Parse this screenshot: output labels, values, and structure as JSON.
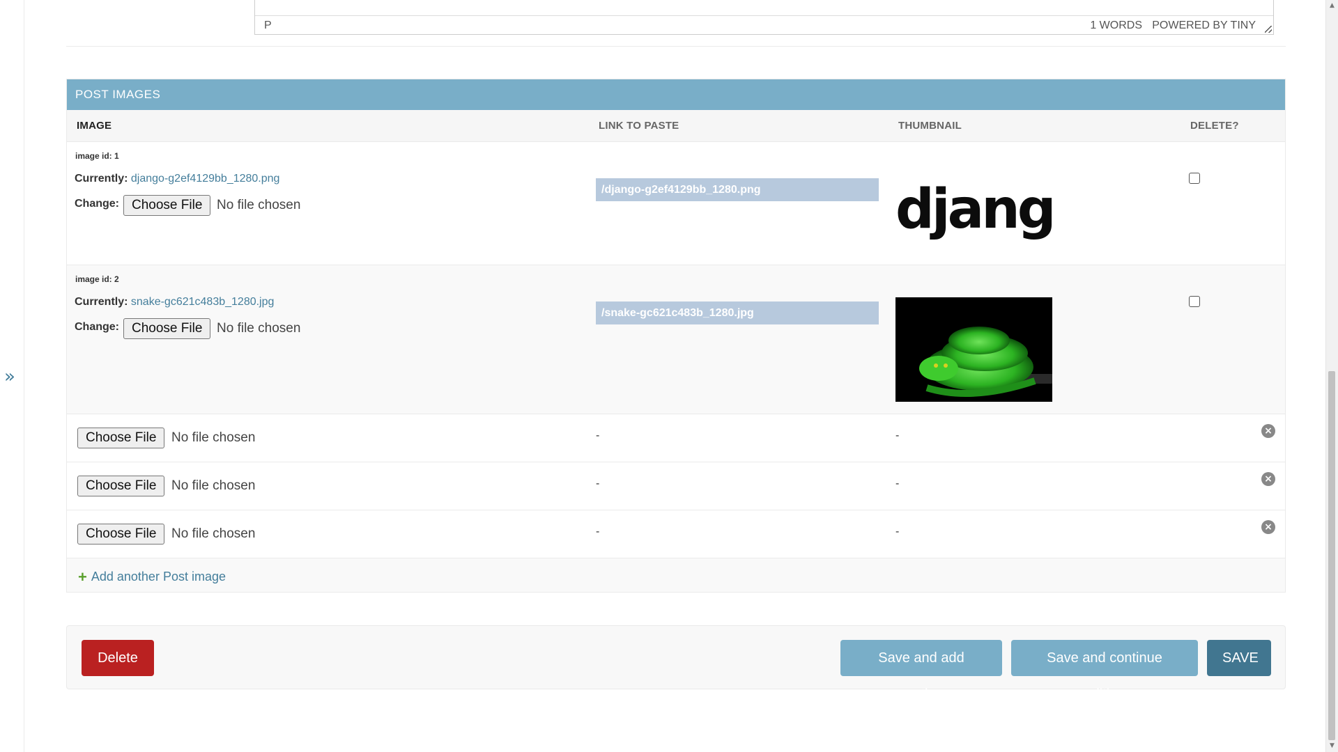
{
  "sidebar": {
    "toggle_glyph": "»"
  },
  "editor": {
    "path": "P",
    "wordcount": "1 WORDS",
    "powered_by": "POWERED BY TINY"
  },
  "inline": {
    "title": "POST IMAGES",
    "columns": {
      "image": "IMAGE",
      "link": "LINK TO PASTE",
      "thumbnail": "THUMBNAIL",
      "delete": "DELETE?"
    },
    "existing": [
      {
        "id_label": "image id: 1",
        "currently_label": "Currently:",
        "current_file": "django-g2ef4129bb_1280.png",
        "change_label": "Change:",
        "button": "Choose File",
        "status": "No file chosen",
        "link": "/django-g2ef4129bb_1280.png",
        "thumb_text": "django"
      },
      {
        "id_label": "image id: 2",
        "currently_label": "Currently:",
        "current_file": "snake-gc621c483b_1280.jpg",
        "change_label": "Change:",
        "button": "Choose File",
        "status": "No file chosen",
        "link": "/snake-gc621c483b_1280.jpg"
      }
    ],
    "empty_rows": [
      {
        "button": "Choose File",
        "status": "No file chosen",
        "link": "-",
        "thumbnail": "-"
      },
      {
        "button": "Choose File",
        "status": "No file chosen",
        "link": "-",
        "thumbnail": "-"
      },
      {
        "button": "Choose File",
        "status": "No file chosen",
        "link": "-",
        "thumbnail": "-"
      }
    ],
    "add_another": "Add another Post image"
  },
  "actions": {
    "delete": "Delete",
    "save_add_another": "Save and add another",
    "save_continue": "Save and continue editing",
    "save": "SAVE"
  },
  "colors": {
    "header_bg": "#79aec8",
    "link": "#447e9b",
    "delete_btn": "#ba2121",
    "save_btn": "#417690",
    "link_box": "#b7c9dd"
  }
}
